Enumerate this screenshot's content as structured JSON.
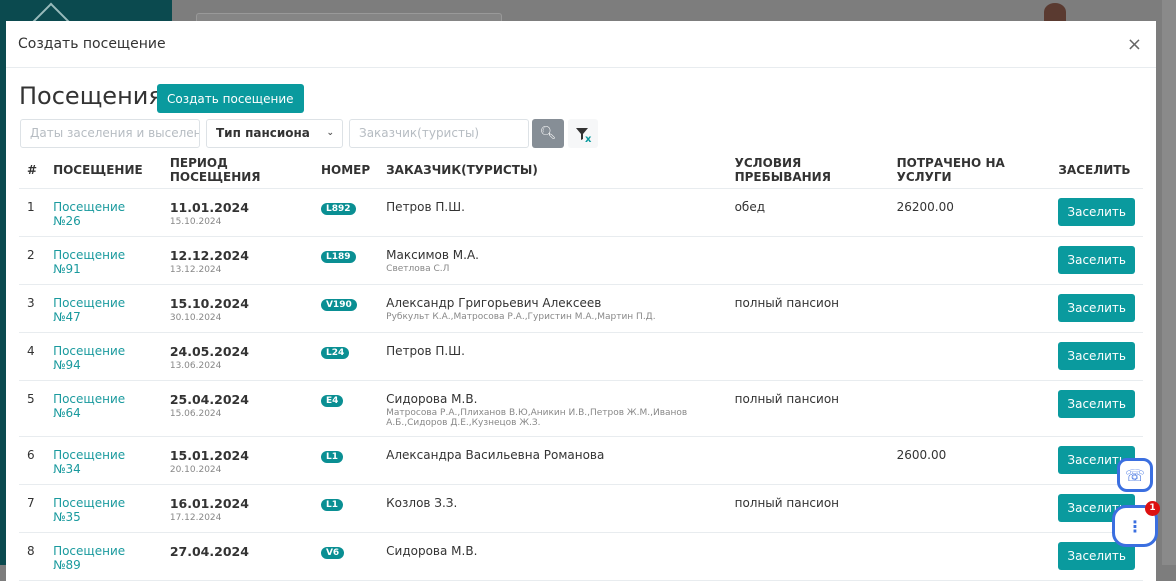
{
  "modal": {
    "title": "Создать посещение",
    "heading": "Посещения",
    "create_label": "Создать посещение",
    "close": "×"
  },
  "filters": {
    "dates_placeholder": "Даты заселения и выселения",
    "board_type": "Тип пансиона",
    "customer_placeholder": "Заказчик(туристы)"
  },
  "columns": [
    "#",
    "ПОСЕЩЕНИЕ",
    "ПЕРИОД ПОСЕЩЕНИЯ",
    "НОМЕР",
    "ЗАКАЗЧИК(ТУРИСТЫ)",
    "УСЛОВИЯ ПРЕБЫВАНИЯ",
    "ПОТРАЧЕНО НА УСЛУГИ",
    "ЗАСЕЛИТЬ"
  ],
  "rows": [
    {
      "n": "1",
      "visit": "Посещение №26",
      "from": "11.01.2024",
      "to": "15.10.2024",
      "room": "L892",
      "customer": "Петров П.Ш.",
      "tourists": "",
      "conditions": "обед",
      "spent": "26200.00",
      "action": "Заселить"
    },
    {
      "n": "2",
      "visit": "Посещение №91",
      "from": "12.12.2024",
      "to": "13.12.2024",
      "room": "L189",
      "customer": "Максимов М.А.",
      "tourists": "Светлова С.Л",
      "conditions": "",
      "spent": "",
      "action": "Заселить"
    },
    {
      "n": "3",
      "visit": "Посещение №47",
      "from": "15.10.2024",
      "to": "30.10.2024",
      "room": "V190",
      "customer": "Александр Григорьевич Алексеев",
      "tourists": "Рубкульт К.А.,Матросова Р.А.,Гуристин М.А.,Мартин П.Д.",
      "conditions": "полный пансион",
      "spent": "",
      "action": "Заселить"
    },
    {
      "n": "4",
      "visit": "Посещение №94",
      "from": "24.05.2024",
      "to": "13.06.2024",
      "room": "L24",
      "customer": "Петров П.Ш.",
      "tourists": "",
      "conditions": "",
      "spent": "",
      "action": "Заселить"
    },
    {
      "n": "5",
      "visit": "Посещение №64",
      "from": "25.04.2024",
      "to": "15.06.2024",
      "room": "E4",
      "customer": "Сидорова М.В.",
      "tourists": "Матросова Р.А.,Плиханов В.Ю,Аникин И.В.,Петров Ж.М.,Иванов А.Б.,Сидоров Д.Е.,Кузнецов Ж.З.",
      "conditions": "полный пансион",
      "spent": "",
      "action": "Заселить"
    },
    {
      "n": "6",
      "visit": "Посещение №34",
      "from": "15.01.2024",
      "to": "20.10.2024",
      "room": "L1",
      "customer": "Александра Васильевна Романова",
      "tourists": "",
      "conditions": "",
      "spent": "2600.00",
      "action": "Заселить"
    },
    {
      "n": "7",
      "visit": "Посещение №35",
      "from": "16.01.2024",
      "to": "17.12.2024",
      "room": "L1",
      "customer": "Козлов З.З.",
      "tourists": "",
      "conditions": "полный пансион",
      "spent": "",
      "action": "Заселить"
    },
    {
      "n": "8",
      "visit": "Посещение №89",
      "from": "27.04.2024",
      "to": "",
      "room": "V6",
      "customer": "Сидорова М.В.",
      "tourists": "",
      "conditions": "",
      "spent": "",
      "action": "Заселить"
    }
  ],
  "chat": {
    "badge": "1"
  }
}
